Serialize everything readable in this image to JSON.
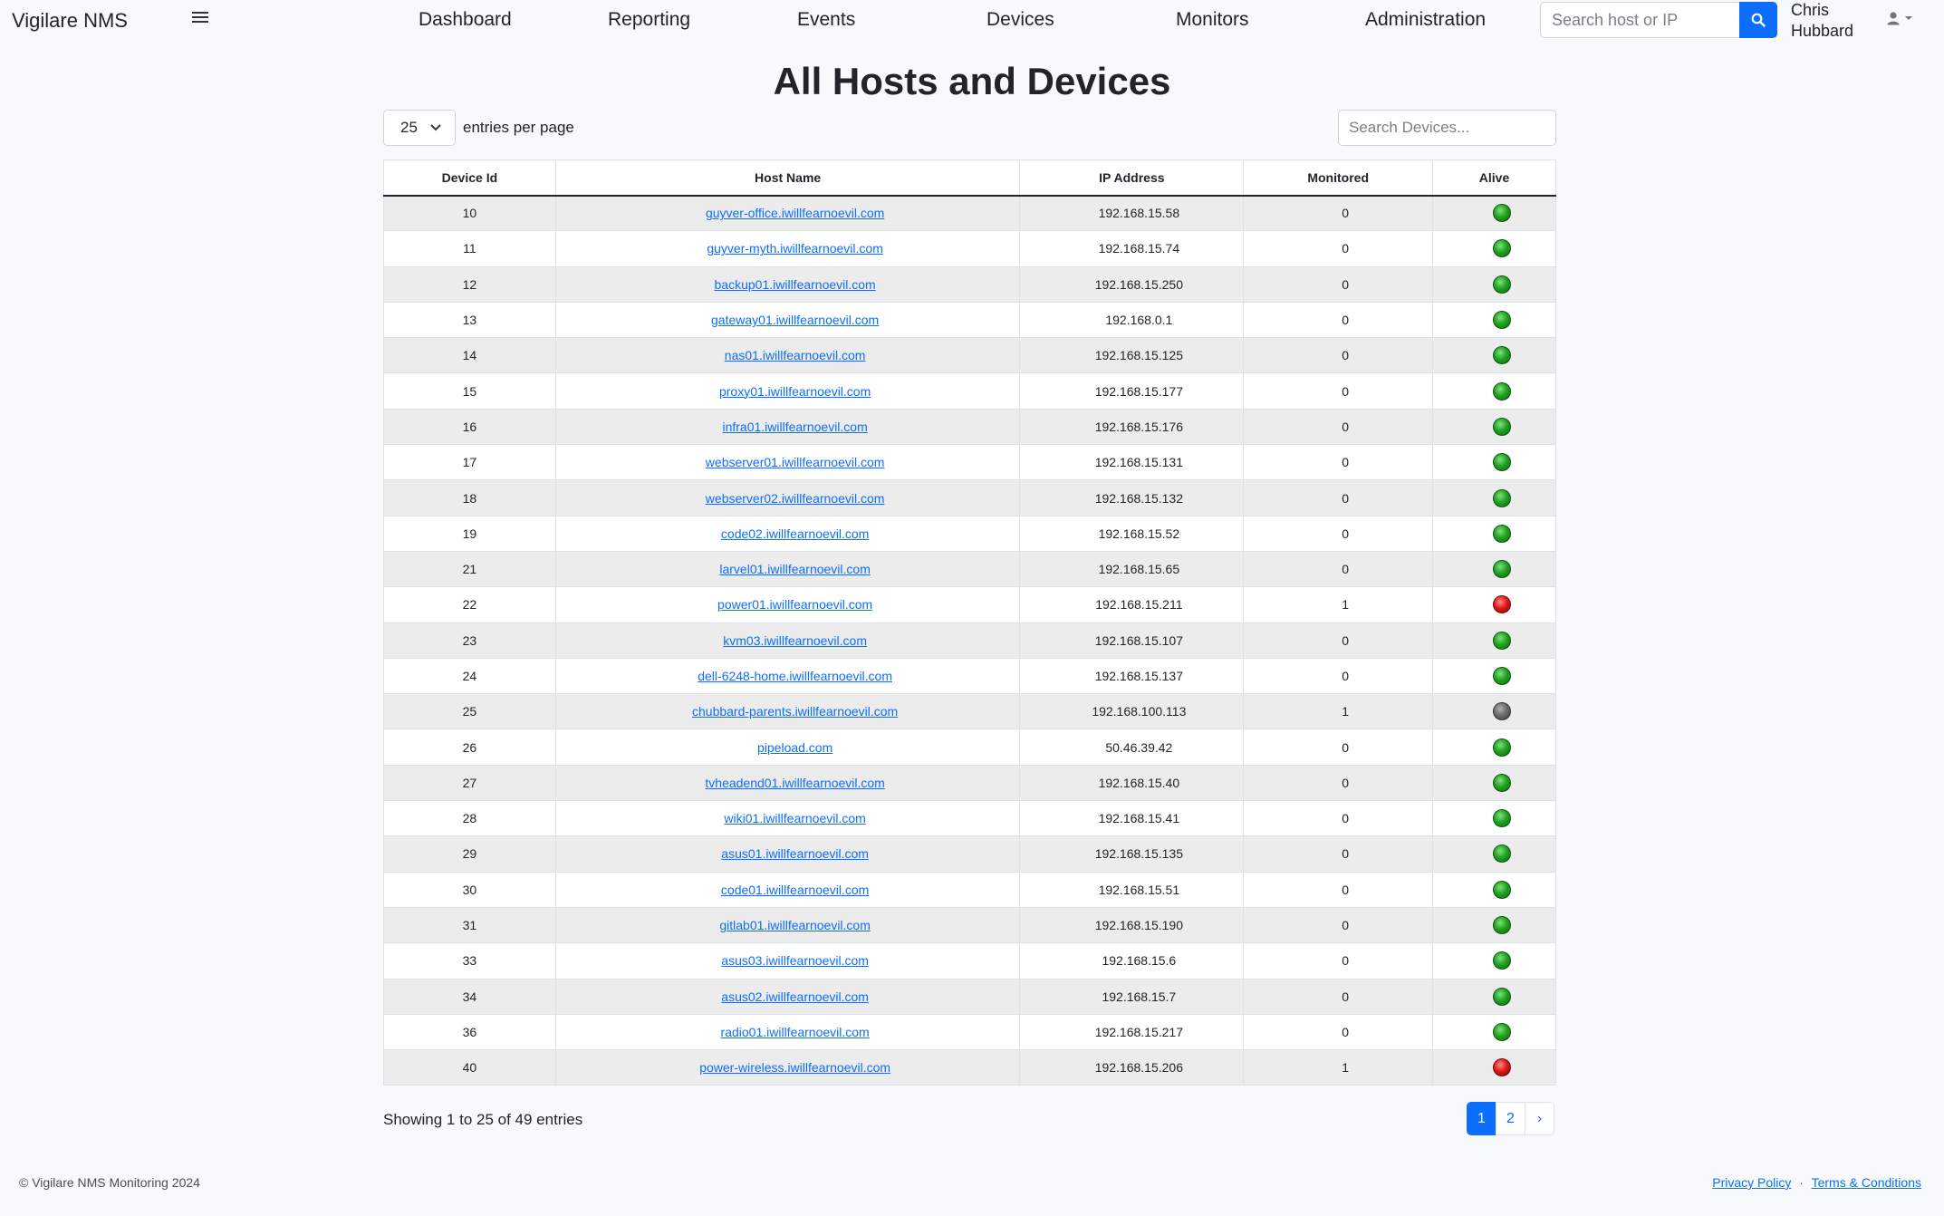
{
  "brand": "Vigilare NMS",
  "nav": {
    "items": [
      "Dashboard",
      "Reporting",
      "Events",
      "Devices",
      "Monitors",
      "Administration"
    ],
    "search_placeholder": "Search host or IP",
    "user_first": "Chris",
    "user_last": "Hubbard"
  },
  "page": {
    "title": "All Hosts and Devices",
    "page_length": "25",
    "length_label": "entries per page",
    "search_placeholder": "Search Devices..."
  },
  "table": {
    "columns": [
      "Device Id",
      "Host Name",
      "IP Address",
      "Monitored",
      "Alive"
    ],
    "rows": [
      {
        "id": "10",
        "host": "guyver-office.iwillfearnoevil.com",
        "ip": "192.168.15.58",
        "monitored": "0",
        "alive": "green"
      },
      {
        "id": "11",
        "host": "guyver-myth.iwillfearnoevil.com",
        "ip": "192.168.15.74",
        "monitored": "0",
        "alive": "green"
      },
      {
        "id": "12",
        "host": "backup01.iwillfearnoevil.com",
        "ip": "192.168.15.250",
        "monitored": "0",
        "alive": "green"
      },
      {
        "id": "13",
        "host": "gateway01.iwillfearnoevil.com",
        "ip": "192.168.0.1",
        "monitored": "0",
        "alive": "green"
      },
      {
        "id": "14",
        "host": "nas01.iwillfearnoevil.com",
        "ip": "192.168.15.125",
        "monitored": "0",
        "alive": "green"
      },
      {
        "id": "15",
        "host": "proxy01.iwillfearnoevil.com",
        "ip": "192.168.15.177",
        "monitored": "0",
        "alive": "green"
      },
      {
        "id": "16",
        "host": "infra01.iwillfearnoevil.com",
        "ip": "192.168.15.176",
        "monitored": "0",
        "alive": "green"
      },
      {
        "id": "17",
        "host": "webserver01.iwillfearnoevil.com",
        "ip": "192.168.15.131",
        "monitored": "0",
        "alive": "green"
      },
      {
        "id": "18",
        "host": "webserver02.iwillfearnoevil.com",
        "ip": "192.168.15.132",
        "monitored": "0",
        "alive": "green"
      },
      {
        "id": "19",
        "host": "code02.iwillfearnoevil.com",
        "ip": "192.168.15.52",
        "monitored": "0",
        "alive": "green"
      },
      {
        "id": "21",
        "host": "larvel01.iwillfearnoevil.com",
        "ip": "192.168.15.65",
        "monitored": "0",
        "alive": "green"
      },
      {
        "id": "22",
        "host": "power01.iwillfearnoevil.com",
        "ip": "192.168.15.211",
        "monitored": "1",
        "alive": "red"
      },
      {
        "id": "23",
        "host": "kvm03.iwillfearnoevil.com",
        "ip": "192.168.15.107",
        "monitored": "0",
        "alive": "green"
      },
      {
        "id": "24",
        "host": "dell-6248-home.iwillfearnoevil.com",
        "ip": "192.168.15.137",
        "monitored": "0",
        "alive": "green"
      },
      {
        "id": "25",
        "host": "chubbard-parents.iwillfearnoevil.com",
        "ip": "192.168.100.113",
        "monitored": "1",
        "alive": "grey"
      },
      {
        "id": "26",
        "host": "pipeload.com",
        "ip": "50.46.39.42",
        "monitored": "0",
        "alive": "green"
      },
      {
        "id": "27",
        "host": "tvheadend01.iwillfearnoevil.com",
        "ip": "192.168.15.40",
        "monitored": "0",
        "alive": "green"
      },
      {
        "id": "28",
        "host": "wiki01.iwillfearnoevil.com",
        "ip": "192.168.15.41",
        "monitored": "0",
        "alive": "green"
      },
      {
        "id": "29",
        "host": "asus01.iwillfearnoevil.com",
        "ip": "192.168.15.135",
        "monitored": "0",
        "alive": "green"
      },
      {
        "id": "30",
        "host": "code01.iwillfearnoevil.com",
        "ip": "192.168.15.51",
        "monitored": "0",
        "alive": "green"
      },
      {
        "id": "31",
        "host": "gitlab01.iwillfearnoevil.com",
        "ip": "192.168.15.190",
        "monitored": "0",
        "alive": "green"
      },
      {
        "id": "33",
        "host": "asus03.iwillfearnoevil.com",
        "ip": "192.168.15.6",
        "monitored": "0",
        "alive": "green"
      },
      {
        "id": "34",
        "host": "asus02.iwillfearnoevil.com",
        "ip": "192.168.15.7",
        "monitored": "0",
        "alive": "green"
      },
      {
        "id": "36",
        "host": "radio01.iwillfearnoevil.com",
        "ip": "192.168.15.217",
        "monitored": "0",
        "alive": "green"
      },
      {
        "id": "40",
        "host": "power-wireless.iwillfearnoevil.com",
        "ip": "192.168.15.206",
        "monitored": "1",
        "alive": "red"
      }
    ]
  },
  "footer": {
    "info": "Showing 1 to 25 of 49 entries",
    "pages": [
      "1",
      "2",
      "›"
    ],
    "active_page": "1",
    "copyright": "© Vigilare NMS Monitoring 2024",
    "privacy": "Privacy Policy",
    "separator": "·",
    "terms": "Terms & Conditions"
  },
  "colors": {
    "accent": "#0d6efd",
    "alive_green": "#22a322",
    "alive_red": "#e01919",
    "alive_grey": "#6d6d6d"
  },
  "icons": {
    "menu": "hamburger-menu-icon",
    "search": "search-icon",
    "user": "user-icon",
    "dropdown": "chevron-down-icon"
  }
}
